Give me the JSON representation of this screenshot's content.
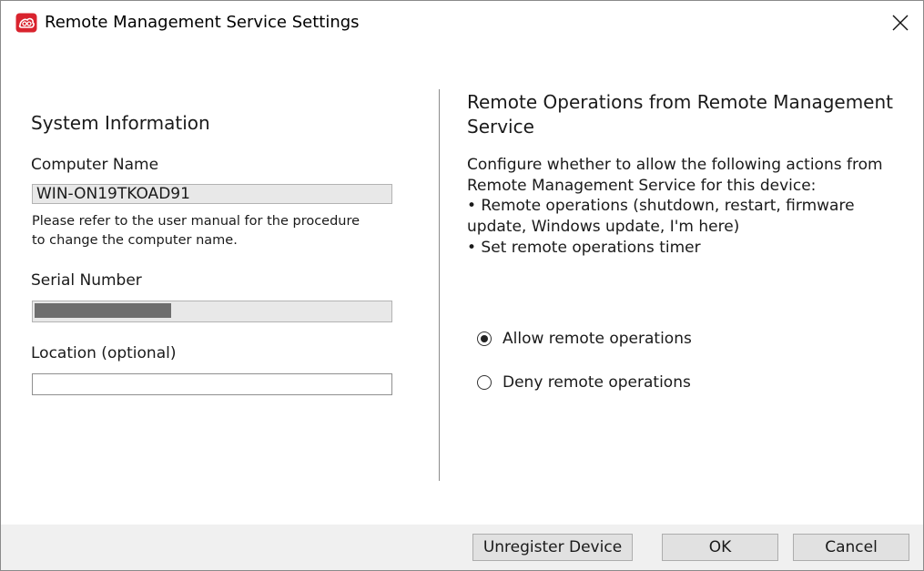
{
  "window": {
    "title": "Remote Management Service Settings",
    "app_icon": "app-logo-icon",
    "close_icon": "close-icon"
  },
  "system_info": {
    "heading": "System Information",
    "computer_name_label": "Computer Name",
    "computer_name_value": "WIN-ON19TKOAD91",
    "computer_name_hint_line1": "Please refer to the user manual for the procedure",
    "computer_name_hint_line2": "to change the computer name.",
    "serial_number_label": "Serial Number",
    "serial_number_value": "",
    "location_label": "Location (optional)",
    "location_value": ""
  },
  "remote_ops": {
    "heading_line1": "Remote Operations from Remote Management",
    "heading_line2": "Service",
    "desc_line1": "Configure whether to allow the following actions from",
    "desc_line2": "Remote Management Service for this device:",
    "desc_line3": "• Remote operations (shutdown, restart, firmware",
    "desc_line4": "update, Windows update, I'm here)",
    "desc_line5": "• Set remote operations timer",
    "options": [
      {
        "label": "Allow remote operations",
        "checked": true
      },
      {
        "label": "Deny remote operations",
        "checked": false
      }
    ]
  },
  "footer": {
    "unregister_label": "Unregister Device",
    "ok_label": "OK",
    "cancel_label": "Cancel"
  },
  "colors": {
    "app_icon_red": "#d9232e",
    "footer_bg": "#f0f0f0",
    "readonly_field_bg": "#e8e8e8"
  }
}
